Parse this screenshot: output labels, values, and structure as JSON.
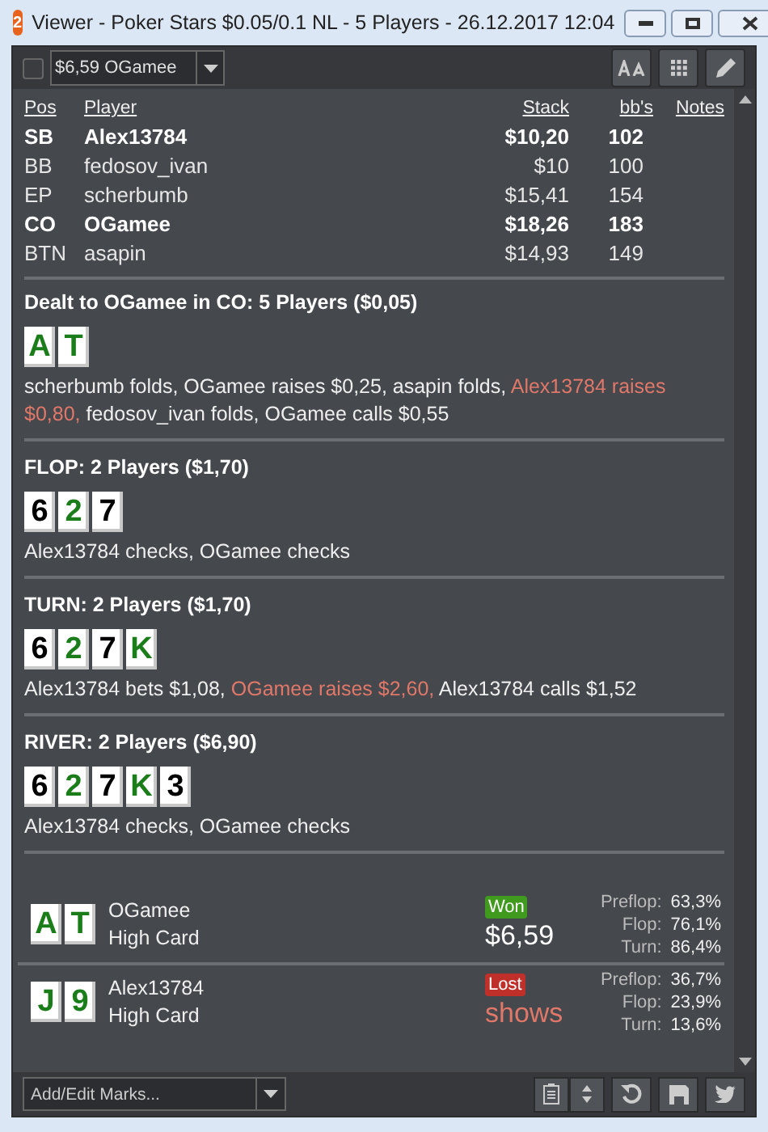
{
  "window": {
    "title": "Viewer - Poker Stars $0.05/0.1 NL - 5 Players - 26.12.2017 12:04",
    "badge": "2"
  },
  "toolbar": {
    "checked": false,
    "hand_select": "$6,59 OGamee"
  },
  "players": {
    "columns": [
      "Pos",
      "Player",
      "Stack",
      "bb's",
      "Notes"
    ],
    "rows": [
      {
        "pos": "SB",
        "player": "Alex13784",
        "stack": "$10,20",
        "bbs": "102",
        "highlighted": true
      },
      {
        "pos": "BB",
        "player": "fedosov_ivan",
        "stack": "$10",
        "bbs": "100",
        "highlighted": false
      },
      {
        "pos": "EP",
        "player": "scherbumb",
        "stack": "$15,41",
        "bbs": "154",
        "highlighted": false
      },
      {
        "pos": "CO",
        "player": "OGamee",
        "stack": "$18,26",
        "bbs": "183",
        "highlighted": true
      },
      {
        "pos": "BTN",
        "player": "asapin",
        "stack": "$14,93",
        "bbs": "149",
        "highlighted": false
      }
    ]
  },
  "streets": [
    {
      "title": "Dealt to OGamee in CO: 5 Players ($0,05)",
      "cards": [
        {
          "rank": "A",
          "color": "#1a7d1a"
        },
        {
          "rank": "T",
          "color": "#1a7d1a"
        }
      ],
      "actions": [
        {
          "text": "scherbumb folds, OGamee raises $0,25, asapin folds, ",
          "aggressive": false
        },
        {
          "text": "Alex13784 raises $0,80,",
          "aggressive": true
        },
        {
          "text": " fedosov_ivan folds, OGamee calls $0,55",
          "aggressive": false
        }
      ]
    },
    {
      "title": "FLOP: 2 Players ($1,70)",
      "cards": [
        {
          "rank": "6",
          "color": "#000000"
        },
        {
          "rank": "2",
          "color": "#1a7d1a"
        },
        {
          "rank": "7",
          "color": "#000000"
        }
      ],
      "actions": [
        {
          "text": "Alex13784 checks, OGamee checks",
          "aggressive": false
        }
      ]
    },
    {
      "title": "TURN: 2 Players ($1,70)",
      "cards": [
        {
          "rank": "6",
          "color": "#000000"
        },
        {
          "rank": "2",
          "color": "#1a7d1a"
        },
        {
          "rank": "7",
          "color": "#000000"
        },
        {
          "rank": "K",
          "color": "#1a7d1a"
        }
      ],
      "actions": [
        {
          "text": "Alex13784 bets $1,08, ",
          "aggressive": false
        },
        {
          "text": "OGamee raises $2,60,",
          "aggressive": true
        },
        {
          "text": " Alex13784 calls $1,52",
          "aggressive": false
        }
      ]
    },
    {
      "title": "RIVER: 2 Players ($6,90)",
      "cards": [
        {
          "rank": "6",
          "color": "#000000"
        },
        {
          "rank": "2",
          "color": "#1a7d1a"
        },
        {
          "rank": "7",
          "color": "#000000"
        },
        {
          "rank": "K",
          "color": "#1a7d1a"
        },
        {
          "rank": "3",
          "color": "#000000"
        }
      ],
      "actions": [
        {
          "text": "Alex13784 checks, OGamee checks",
          "aggressive": false
        }
      ]
    }
  ],
  "showdown": [
    {
      "cards": [
        {
          "rank": "A",
          "color": "#1a7d1a"
        },
        {
          "rank": "T",
          "color": "#1a7d1a"
        }
      ],
      "player": "OGamee",
      "hand": "High Card",
      "won": true,
      "result_label": "Won",
      "amount": "$6,59",
      "equity": [
        {
          "street": "Preflop:",
          "value": "63,3%"
        },
        {
          "street": "Flop:",
          "value": "76,1%"
        },
        {
          "street": "Turn:",
          "value": "86,4%"
        }
      ]
    },
    {
      "cards": [
        {
          "rank": "J",
          "color": "#1a7d1a"
        },
        {
          "rank": "9",
          "color": "#1a7d1a"
        }
      ],
      "player": "Alex13784",
      "hand": "High Card",
      "won": false,
      "result_label": "Lost",
      "amount": "shows",
      "equity": [
        {
          "street": "Preflop:",
          "value": "36,7%"
        },
        {
          "street": "Flop:",
          "value": "23,9%"
        },
        {
          "street": "Turn:",
          "value": "13,6%"
        }
      ]
    }
  ],
  "bottom_bar": {
    "marks_placeholder": "Add/Edit Marks..."
  }
}
